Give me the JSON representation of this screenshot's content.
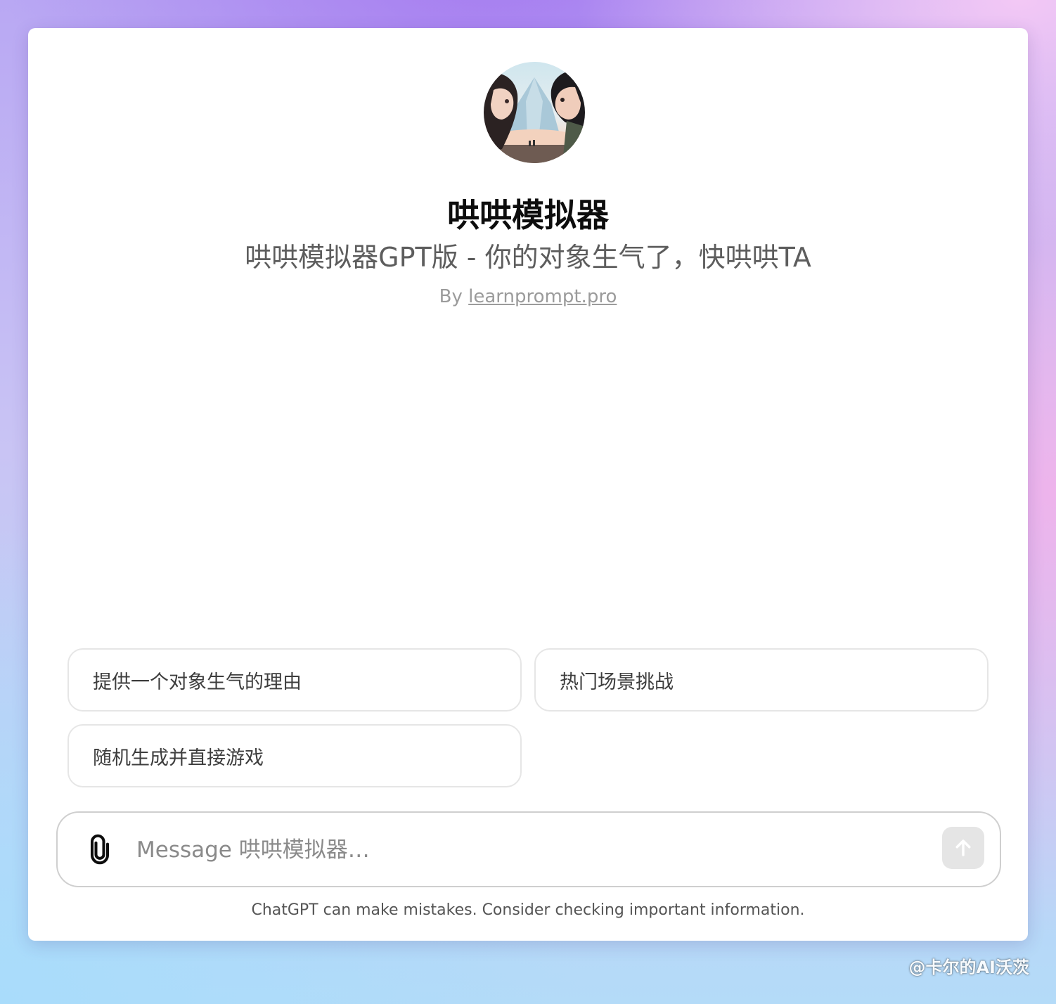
{
  "gpt": {
    "avatar_icon": "couple-illustration-avatar",
    "title": "哄哄模拟器",
    "description": "哄哄模拟器GPT版 - 你的对象生气了，快哄哄TA",
    "by_prefix": "By ",
    "author": "learnprompt.pro"
  },
  "conversation_starters": [
    {
      "label": "提供一个对象生气的理由"
    },
    {
      "label": "热门场景挑战"
    },
    {
      "label": "随机生成并直接游戏"
    }
  ],
  "composer": {
    "placeholder": "Message 哄哄模拟器…",
    "attach_icon": "paperclip-icon",
    "send_icon": "arrow-up-icon"
  },
  "disclaimer": "ChatGPT can make mistakes. Consider checking important information.",
  "watermark": "@卡尔的AI沃茨"
}
